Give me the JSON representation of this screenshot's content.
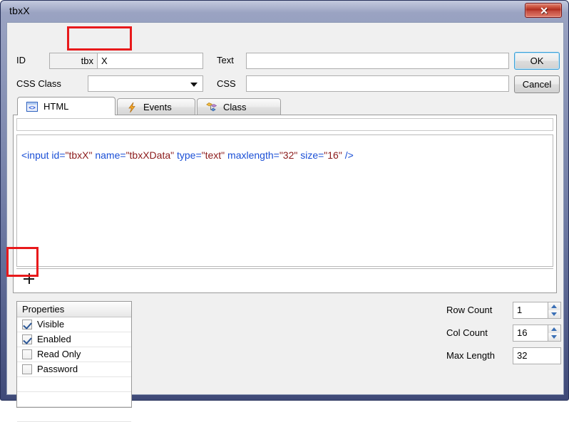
{
  "window": {
    "title": "tbxX",
    "close_label": "✕"
  },
  "form": {
    "id_label": "ID",
    "id_prefix": "tbx",
    "id_value": "X",
    "cssclass_label": "CSS Class",
    "cssclass_value": "",
    "text_label": "Text",
    "text_value": "",
    "css_label": "CSS",
    "css_value": "",
    "ok_label": "OK",
    "cancel_label": "Cancel"
  },
  "tabs": [
    {
      "label": "HTML",
      "icon": "code-brackets-icon",
      "active": true
    },
    {
      "label": "Events",
      "icon": "lightning-bolt-icon",
      "active": false
    },
    {
      "label": "Class",
      "icon": "diamonds-icon",
      "active": false
    }
  ],
  "editor": {
    "code_tokens": [
      {
        "t": "<input",
        "c": "c-tag"
      },
      {
        "t": " id=",
        "c": "c-attr"
      },
      {
        "t": "\"tbxX\"",
        "c": "c-val"
      },
      {
        "t": " name=",
        "c": "c-attr"
      },
      {
        "t": "\"tbxXData\"",
        "c": "c-val"
      },
      {
        "t": " type=",
        "c": "c-attr"
      },
      {
        "t": "\"text\"",
        "c": "c-val"
      },
      {
        "t": " maxlength=",
        "c": "c-attr"
      },
      {
        "t": "\"32\"",
        "c": "c-val"
      },
      {
        "t": " size=",
        "c": "c-attr"
      },
      {
        "t": "\"16\"",
        "c": "c-val"
      },
      {
        "t": " />",
        "c": "c-punc"
      }
    ],
    "expander_label": "+"
  },
  "properties": {
    "header": "Properties",
    "items": [
      {
        "label": "Visible",
        "checked": true
      },
      {
        "label": "Enabled",
        "checked": true
      },
      {
        "label": "Read Only",
        "checked": false
      },
      {
        "label": "Password",
        "checked": false
      }
    ]
  },
  "counts": {
    "row_count_label": "Row Count",
    "row_count_value": "1",
    "col_count_label": "Col Count",
    "col_count_value": "16",
    "max_length_label": "Max Length",
    "max_length_value": "32"
  },
  "colors": {
    "titlebar_dark": "#3f4a78",
    "close_red": "#ad2a1c",
    "annotation_red": "#e8191b",
    "tag_blue": "#1a4fd6",
    "value_maroon": "#8b1a1a",
    "focus_blue": "#3c9fd6"
  }
}
